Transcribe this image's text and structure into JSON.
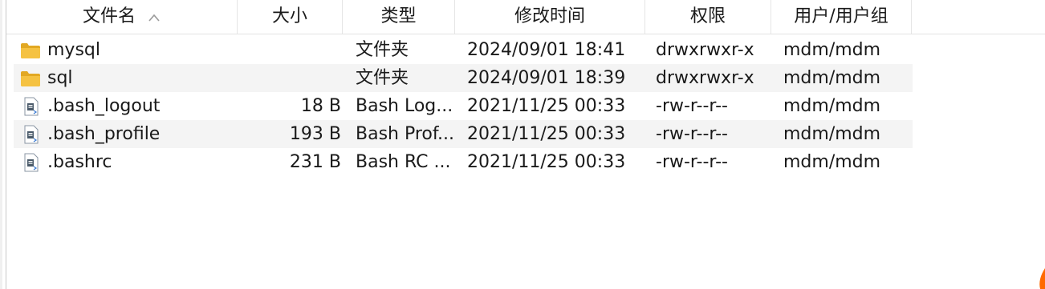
{
  "columns": {
    "name": "文件名",
    "size": "大小",
    "type": "类型",
    "modified": "修改时间",
    "permissions": "权限",
    "owner": "用户/用户组"
  },
  "sort": {
    "column": "name",
    "direction": "ascending",
    "icon": "sort-up-chevron-icon"
  },
  "files": [
    {
      "icon": "folder-icon",
      "name": "mysql",
      "size": "",
      "type": "文件夹",
      "modified": "2024/09/01 18:41",
      "permissions": "drwxrwxr-x",
      "owner": "mdm/mdm"
    },
    {
      "icon": "folder-icon",
      "name": "sql",
      "size": "",
      "type": "文件夹",
      "modified": "2024/09/01 18:39",
      "permissions": "drwxrwxr-x",
      "owner": "mdm/mdm"
    },
    {
      "icon": "script-file-icon",
      "name": ".bash_logout",
      "size": "18 B",
      "type": "Bash Log...",
      "modified": "2021/11/25 00:33",
      "permissions": "-rw-r--r--",
      "owner": "mdm/mdm"
    },
    {
      "icon": "script-file-icon",
      "name": ".bash_profile",
      "size": "193 B",
      "type": "Bash Prof...",
      "modified": "2021/11/25 00:33",
      "permissions": "-rw-r--r--",
      "owner": "mdm/mdm"
    },
    {
      "icon": "script-file-icon",
      "name": ".bashrc",
      "size": "231 B",
      "type": "Bash RC ...",
      "modified": "2021/11/25 00:33",
      "permissions": "-rw-r--r--",
      "owner": "mdm/mdm"
    }
  ],
  "colors": {
    "folder": "#f5c242",
    "folder_dark": "#e2a823",
    "alt_row": "#f4f4f4",
    "file_icon": "#4a5a6a",
    "accent": "#ff6a00"
  }
}
